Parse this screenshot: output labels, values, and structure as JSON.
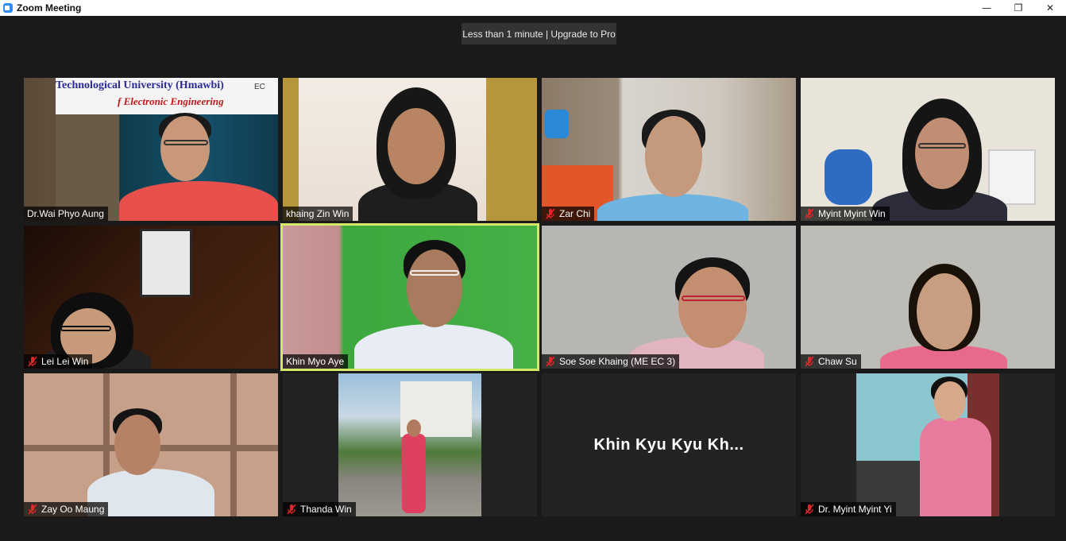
{
  "window": {
    "title": "Zoom Meeting"
  },
  "window_controls": {
    "minimize": "—",
    "restore": "❐",
    "close": "✕"
  },
  "banner": {
    "text": "Less than 1 minute | Upgrade to Pro"
  },
  "tile_overlay": {
    "university": "Technological University (Hmawbi)",
    "department": "f Electronic Engineering",
    "badge": "EC"
  },
  "participants": [
    {
      "name": "Dr.Wai Phyo Aung",
      "muted": false
    },
    {
      "name": "khaing Zin Win",
      "muted": false
    },
    {
      "name": "Zar Chi",
      "muted": true
    },
    {
      "name": "Myint Myint Win",
      "muted": true
    },
    {
      "name": "Lei Lei Win",
      "muted": true
    },
    {
      "name": "Khin Myo Aye",
      "muted": false,
      "active_speaker": true
    },
    {
      "name": "Soe Soe Khaing (ME EC 3)",
      "muted": true
    },
    {
      "name": "Chaw Su",
      "muted": true
    },
    {
      "name": "Zay Oo Maung",
      "muted": true
    },
    {
      "name": "Thanda Win",
      "muted": true
    },
    {
      "name": "Khin Kyu Kyu Kh...",
      "muted": false,
      "video_off": true
    },
    {
      "name": "Dr. Myint Myint Yi",
      "muted": true
    }
  ],
  "colors": {
    "active_border": "#d6e86a",
    "mute_red": "#e02828",
    "background": "#1a1a1a"
  }
}
